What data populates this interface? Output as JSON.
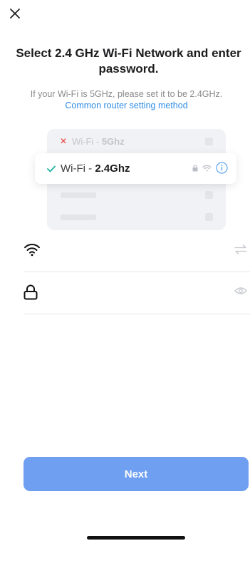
{
  "header": {
    "close_icon": "close-icon"
  },
  "title": "Select 2.4 GHz Wi-Fi Network and enter password.",
  "hint": {
    "text": "If your Wi-Fi is 5GHz, please set it to be 2.4GHz.",
    "link": "Common router setting method"
  },
  "illustration": {
    "bad_network_prefix": "Wi-Fi - ",
    "bad_network_band": "5Ghz",
    "good_network_prefix": "Wi-Fi - ",
    "good_network_band": "2.4Ghz"
  },
  "form": {
    "ssid": {
      "value": "",
      "placeholder": "",
      "icon": "wifi-icon",
      "action_icon": "switch-arrows-icon"
    },
    "password": {
      "value": "",
      "placeholder": "",
      "icon": "lock-icon",
      "action_icon": "eye-icon"
    }
  },
  "next_button": "Next",
  "colors": {
    "accent": "#6f9ff0",
    "link": "#2d8ce6",
    "error": "#e94242",
    "success": "#1fb5a1",
    "info": "#5aa5f2"
  }
}
